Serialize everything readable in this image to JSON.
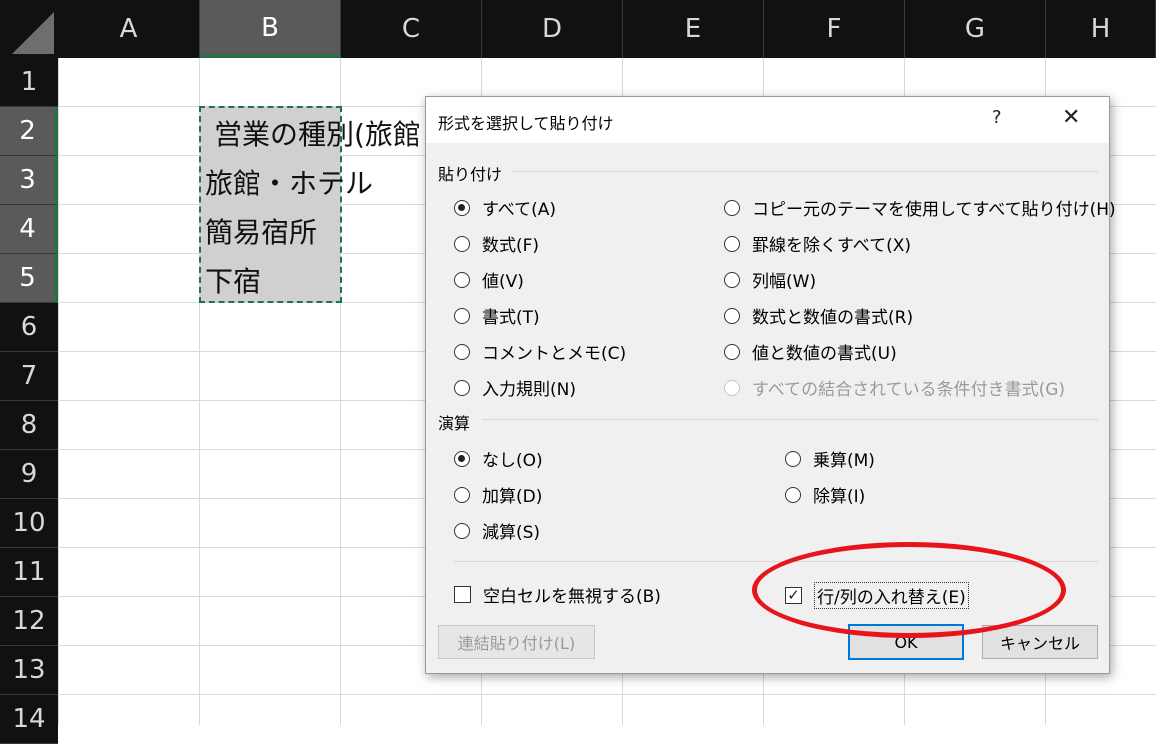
{
  "sheet": {
    "columns": [
      "A",
      "B",
      "C",
      "D",
      "E",
      "F",
      "G",
      "H"
    ],
    "rows": [
      "1",
      "2",
      "3",
      "4",
      "5",
      "6",
      "7",
      "8",
      "9",
      "10",
      "11",
      "12",
      "13",
      "14"
    ],
    "selected_column": "B",
    "selected_rows": [
      "2",
      "3",
      "4",
      "5"
    ],
    "cells": {
      "B2": "営業の種別(旅館",
      "B3": "旅館・ホテル",
      "B4": "簡易宿所",
      "B5": "下宿"
    }
  },
  "dialog": {
    "title": "形式を選択して貼り付け",
    "help": "?",
    "close": "✕",
    "paste_section": "貼り付け",
    "paste_left": [
      {
        "label": "すべて(A)",
        "checked": true
      },
      {
        "label": "数式(F)",
        "checked": false
      },
      {
        "label": "値(V)",
        "checked": false
      },
      {
        "label": "書式(T)",
        "checked": false
      },
      {
        "label": "コメントとメモ(C)",
        "checked": false
      },
      {
        "label": "入力規則(N)",
        "checked": false
      }
    ],
    "paste_right": [
      {
        "label": "コピー元のテーマを使用してすべて貼り付け(H)",
        "checked": false
      },
      {
        "label": "罫線を除くすべて(X)",
        "checked": false
      },
      {
        "label": "列幅(W)",
        "checked": false
      },
      {
        "label": "数式と数値の書式(R)",
        "checked": false
      },
      {
        "label": "値と数値の書式(U)",
        "checked": false
      },
      {
        "label": "すべての結合されている条件付き書式(G)",
        "checked": false,
        "disabled": true
      }
    ],
    "operation_section": "演算",
    "operation_left": [
      {
        "label": "なし(O)",
        "checked": true
      },
      {
        "label": "加算(D)",
        "checked": false
      },
      {
        "label": "減算(S)",
        "checked": false
      }
    ],
    "operation_right": [
      {
        "label": "乗算(M)",
        "checked": false
      },
      {
        "label": "除算(I)",
        "checked": false
      }
    ],
    "skip_blanks": {
      "label": "空白セルを無視する(B)",
      "checked": false
    },
    "transpose": {
      "label": "行/列の入れ替え(E)",
      "checked": true,
      "check_glyph": "✓"
    },
    "paste_link_button": "連結貼り付け(L)",
    "ok_button": "OK",
    "cancel_button": "キャンセル"
  },
  "colors": {
    "highlight_ellipse": "#e8141c",
    "selection_border": "#217346",
    "default_button_border": "#0078d7"
  }
}
